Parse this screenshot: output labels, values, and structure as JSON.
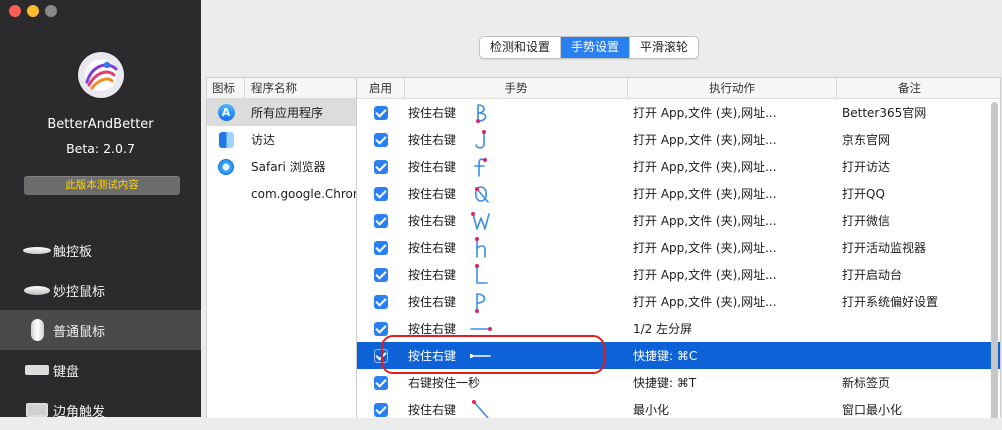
{
  "sidebar": {
    "app_name": "BetterAndBetter",
    "version": "Beta: 2.0.7",
    "test_button": "此版本测试内容",
    "nav": [
      {
        "label": "触控板",
        "icon": "trackpad-icon"
      },
      {
        "label": "妙控鼠标",
        "icon": "magic-mouse-icon"
      },
      {
        "label": "普通鼠标",
        "icon": "mouse-icon"
      },
      {
        "label": "键盘",
        "icon": "keyboard-icon"
      },
      {
        "label": "边角触发",
        "icon": "hot-corner-icon"
      }
    ]
  },
  "tabs": [
    {
      "label": "检测和设置",
      "active": false
    },
    {
      "label": "手势设置",
      "active": true
    },
    {
      "label": "平滑滚轮",
      "active": false
    }
  ],
  "applist": {
    "headers": {
      "icon": "图标",
      "name": "程序名称"
    },
    "rows": [
      {
        "icon": "app-store-icon",
        "name": "所有应用程序"
      },
      {
        "icon": "finder-icon",
        "name": "访达"
      },
      {
        "icon": "safari-icon",
        "name": "Safari 浏览器"
      },
      {
        "icon": "",
        "name": "com.google.Chrome"
      }
    ]
  },
  "table": {
    "headers": {
      "enabled": "启用",
      "gesture": "手势",
      "action": "执行动作",
      "note": "备注"
    },
    "rows": [
      {
        "gesture": "按住右键",
        "shape": "B",
        "action": "打开 App,文件 (夹),网址...",
        "note": "Better365官网"
      },
      {
        "gesture": "按住右键",
        "shape": "J",
        "action": "打开 App,文件 (夹),网址...",
        "note": "京东官网"
      },
      {
        "gesture": "按住右键",
        "shape": "F",
        "action": "打开 App,文件 (夹),网址...",
        "note": "打开访达"
      },
      {
        "gesture": "按住右键",
        "shape": "Q",
        "action": "打开 App,文件 (夹),网址...",
        "note": "打开QQ"
      },
      {
        "gesture": "按住右键",
        "shape": "W",
        "action": "打开 App,文件 (夹),网址...",
        "note": "打开微信"
      },
      {
        "gesture": "按住右键",
        "shape": "h",
        "action": "打开 App,文件 (夹),网址...",
        "note": "打开活动监视器"
      },
      {
        "gesture": "按住右键",
        "shape": "L",
        "action": "打开 App,文件 (夹),网址...",
        "note": "打开启动台"
      },
      {
        "gesture": "按住右键",
        "shape": "P",
        "action": "打开 App,文件 (夹),网址...",
        "note": "打开系统偏好设置"
      },
      {
        "gesture": "按住右键",
        "shape": "right",
        "action": "1/2 左分屏",
        "note": ""
      },
      {
        "gesture": "按住右键",
        "shape": "left",
        "action": "快捷键: ⌘C",
        "note": "",
        "selected": true
      },
      {
        "gesture": "右键按住一秒",
        "shape": "",
        "action": "快捷键: ⌘T",
        "note": "新标签页"
      },
      {
        "gesture": "按住右键",
        "shape": "diag",
        "action": "最小化",
        "note": "窗口最小化"
      }
    ]
  },
  "colors": {
    "accent": "#2a80f0",
    "selected_row": "#0d62d8",
    "stroke": "#3b8de8",
    "stroke_start": "#e0245e",
    "highlight": "#e21d1d",
    "test_text": "#ffd60a"
  }
}
